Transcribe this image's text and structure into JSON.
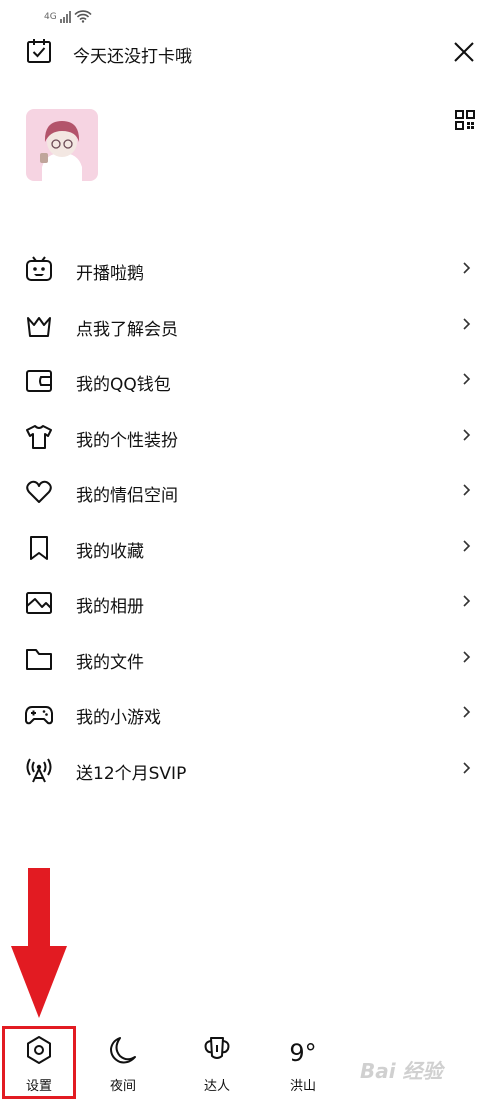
{
  "status_bar": {
    "network": "4G"
  },
  "header": {
    "checkin_text": "今天还没打卡哦"
  },
  "menu": [
    {
      "label": "开播啦鹅",
      "icon": "tv-icon"
    },
    {
      "label": "点我了解会员",
      "icon": "crown-icon"
    },
    {
      "label": "我的QQ钱包",
      "icon": "wallet-icon"
    },
    {
      "label": "我的个性装扮",
      "icon": "tshirt-icon"
    },
    {
      "label": "我的情侣空间",
      "icon": "heart-icon"
    },
    {
      "label": "我的收藏",
      "icon": "bookmark-icon"
    },
    {
      "label": "我的相册",
      "icon": "album-icon"
    },
    {
      "label": "我的文件",
      "icon": "folder-icon"
    },
    {
      "label": "我的小游戏",
      "icon": "gamepad-icon"
    },
    {
      "label": "送12个月SVIP",
      "icon": "antenna-icon"
    }
  ],
  "bottom_bar": {
    "settings": "设置",
    "night": "夜间",
    "expert": "达人",
    "weather_temp": "9°",
    "weather_city": "洪山"
  },
  "watermark": "Bai 经验",
  "colors": {
    "highlight": "#e21b22",
    "text": "#111111",
    "background": "#ffffff"
  }
}
